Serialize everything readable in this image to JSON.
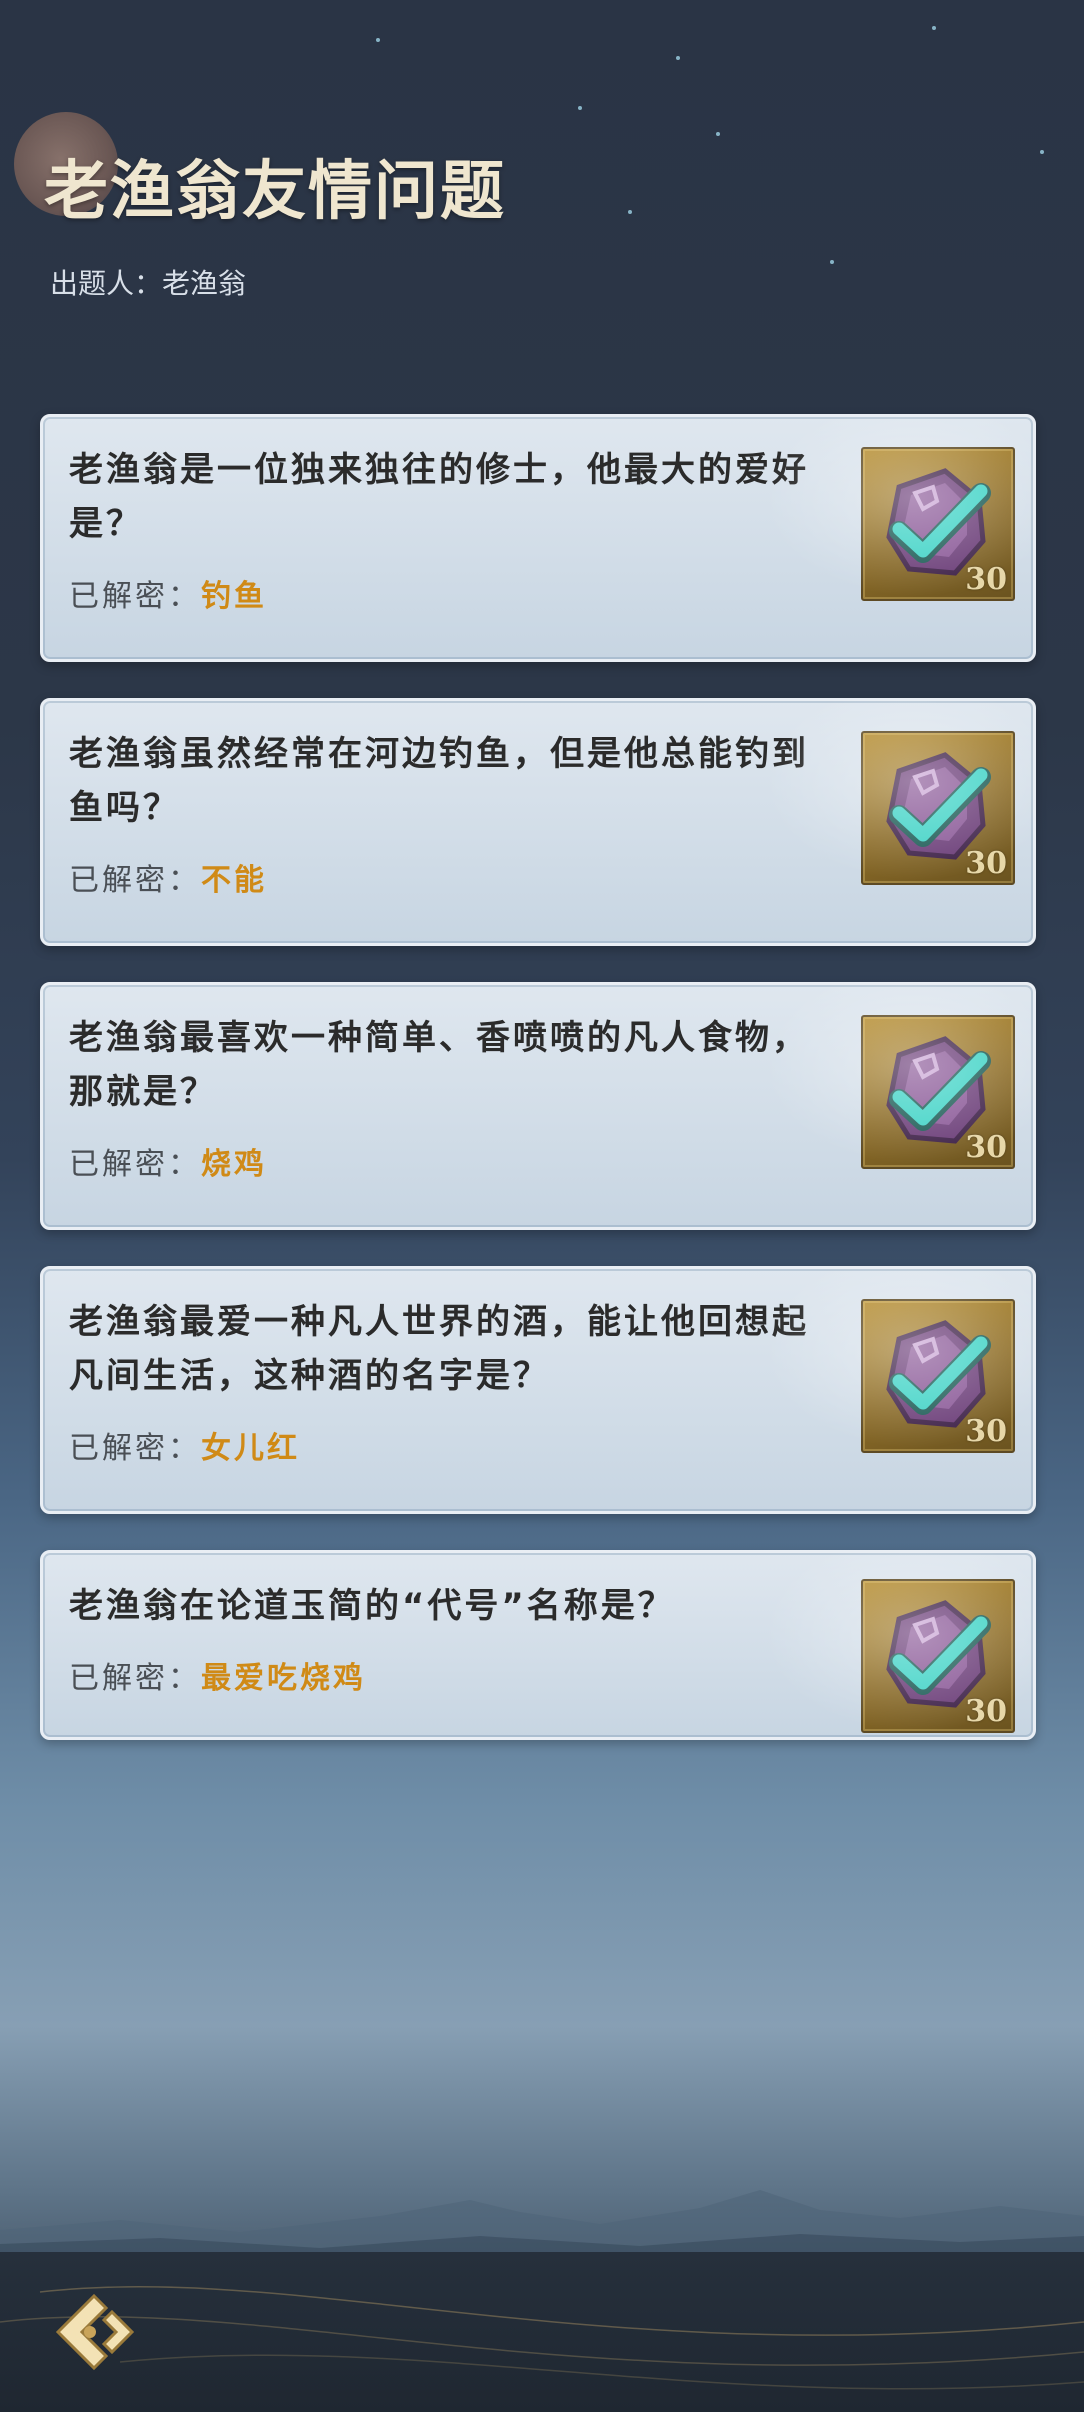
{
  "header": {
    "title": "老渔翁友情问题",
    "author_line": "出题人：老渔翁"
  },
  "cards": [
    {
      "question": "老渔翁是一位独来独往的修士，他最大的爱好是？",
      "answer_label": "已解密：",
      "answer": "钓鱼",
      "badge_count": "30"
    },
    {
      "question": "老渔翁虽然经常在河边钓鱼，但是他总能钓到鱼吗？",
      "answer_label": "已解密：",
      "answer": "不能",
      "badge_count": "30"
    },
    {
      "question": "老渔翁最喜欢一种简单、香喷喷的凡人食物，那就是？",
      "answer_label": "已解密：",
      "answer": "烧鸡",
      "badge_count": "30"
    },
    {
      "question": "老渔翁最爱一种凡人世界的酒，能让他回想起凡间生活，这种酒的名字是？",
      "answer_label": "已解密：",
      "answer": "女儿红",
      "badge_count": "30"
    },
    {
      "question": "老渔翁在论道玉简的“代号”名称是？",
      "answer_label": "已解密：",
      "answer": "最爱吃烧鸡",
      "badge_count": "30"
    }
  ],
  "icons": {
    "badge": "solved-check-icon",
    "back": "back-arrow-icon"
  },
  "colors": {
    "answer": "#d08a16",
    "check": "#3fd3c6",
    "title": "#efe6cf"
  }
}
